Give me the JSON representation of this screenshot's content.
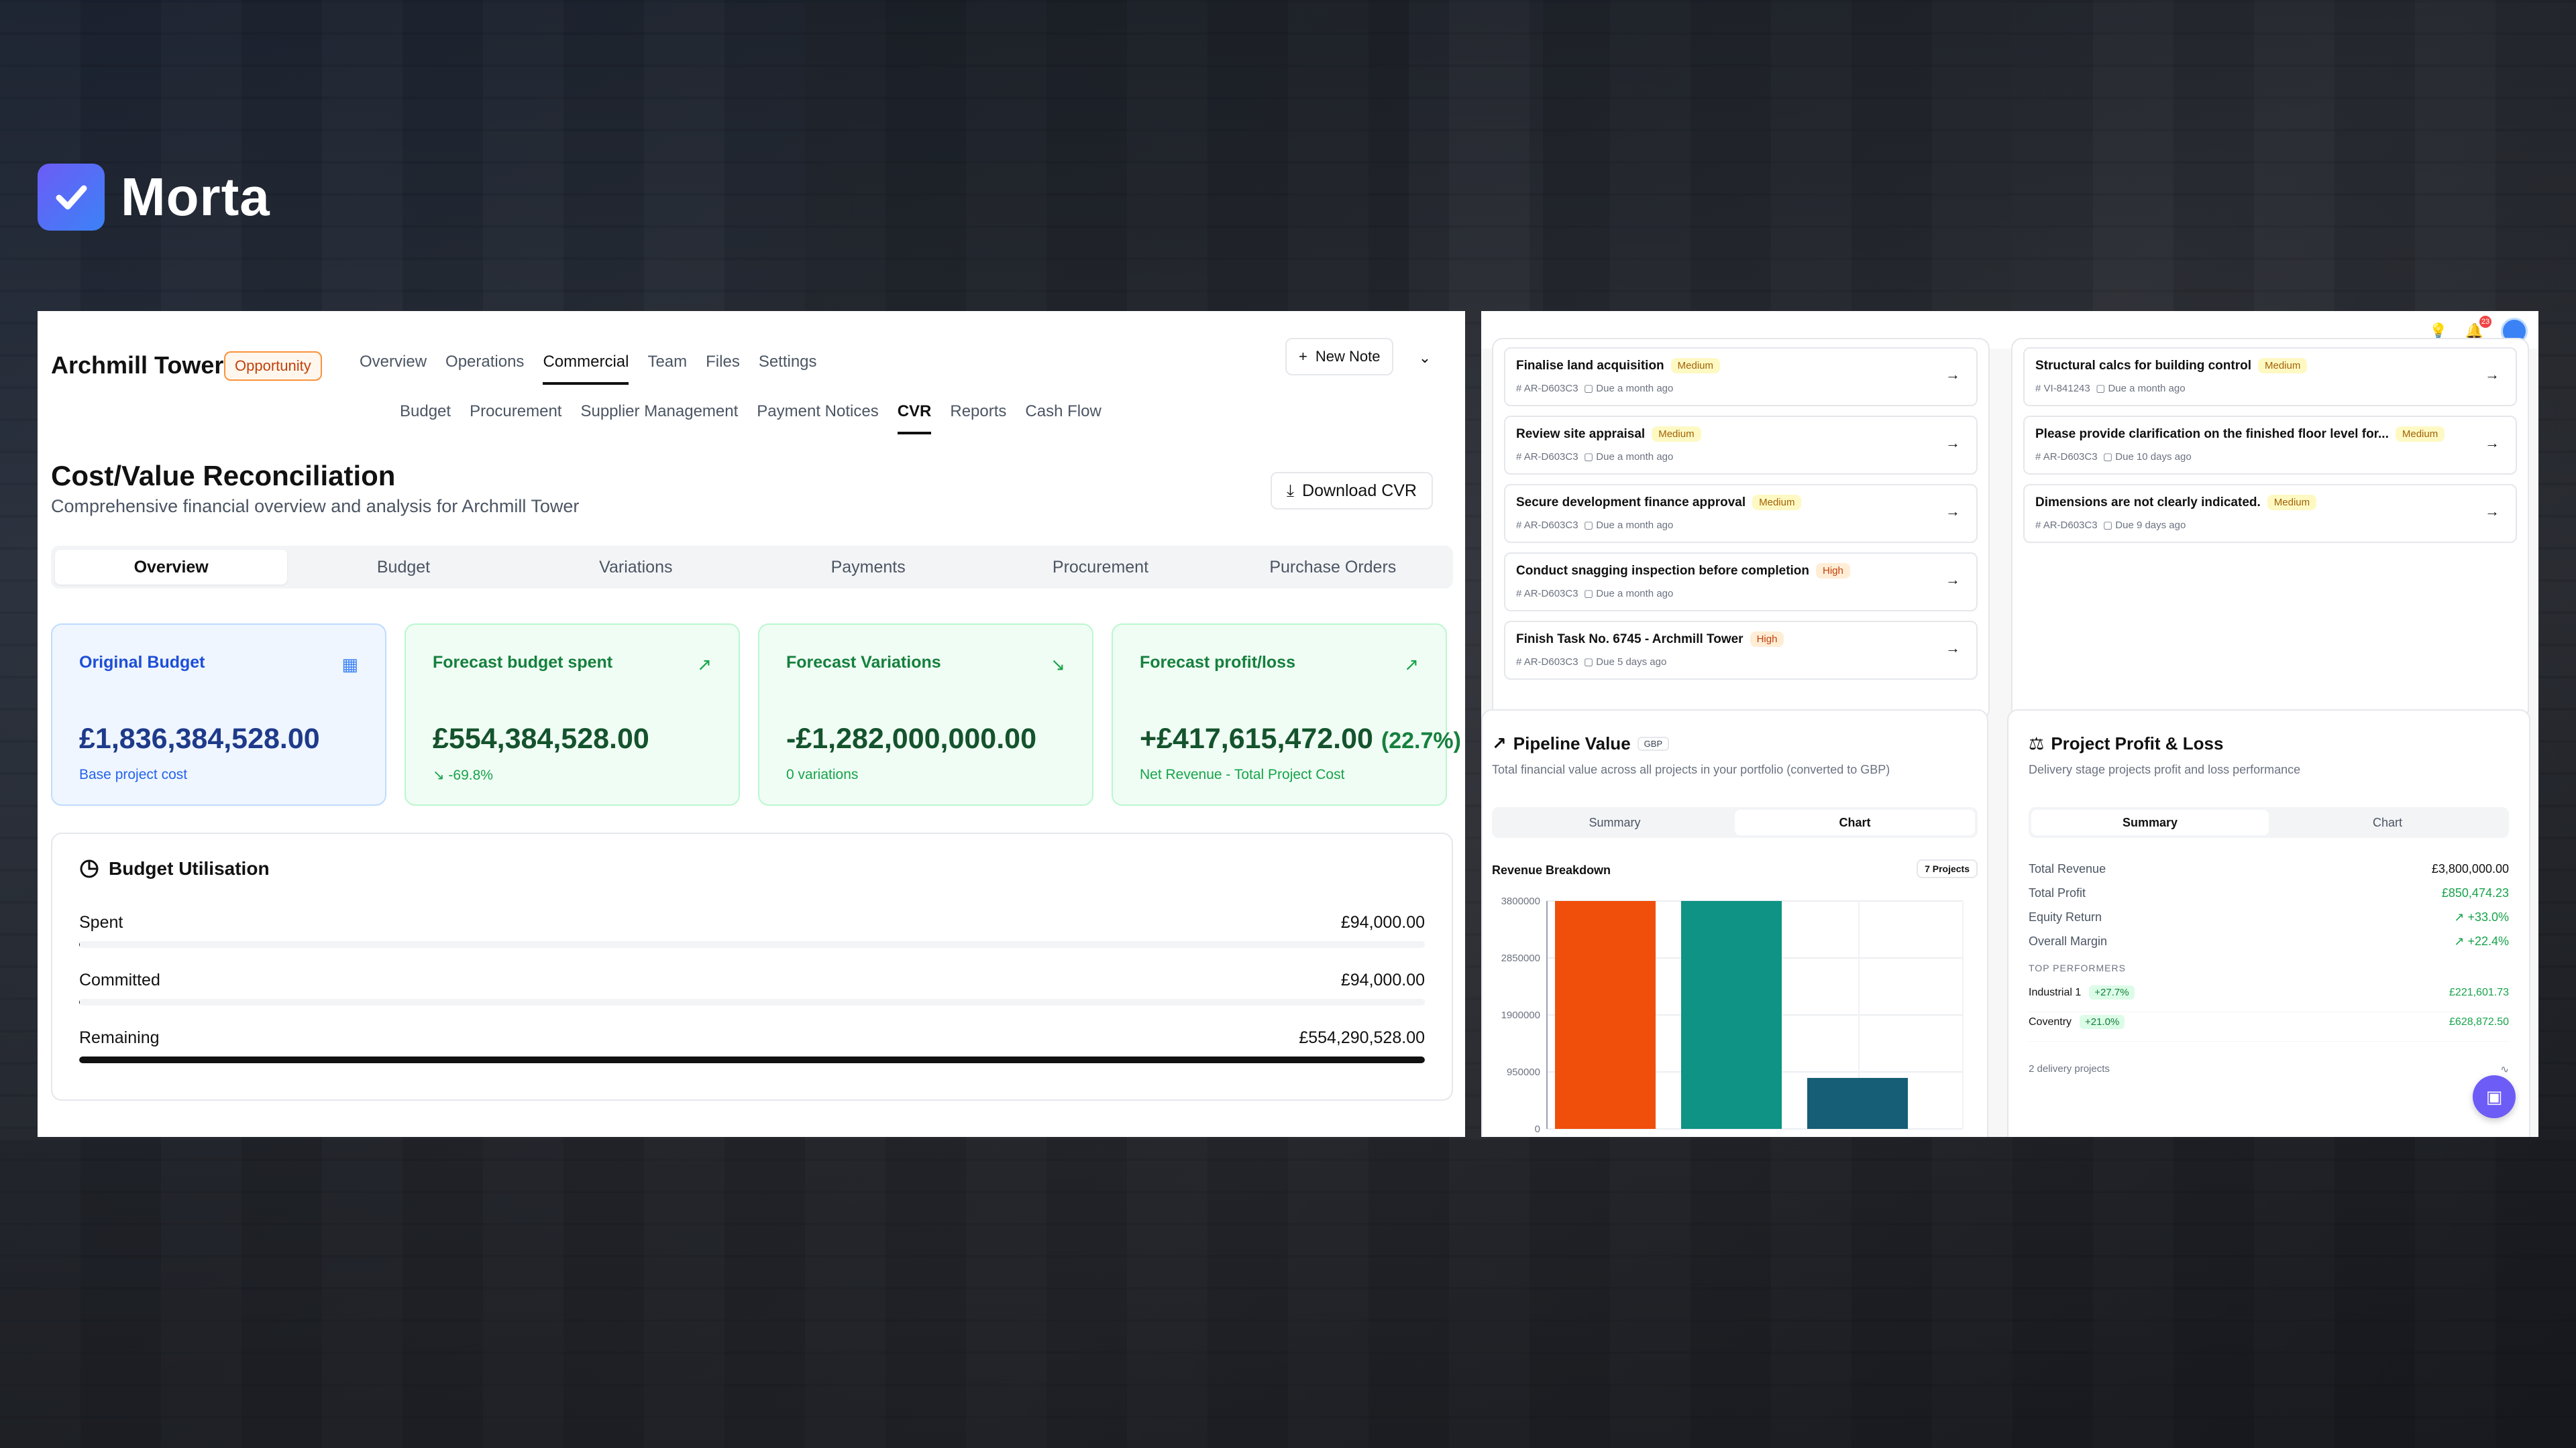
{
  "brand": {
    "name": "Morta",
    "logo_icon": "checkmark-icon",
    "accent": "#6d5cf6"
  },
  "project": {
    "title": "Archmill Tower",
    "badge": "Opportunity"
  },
  "topnav": [
    {
      "label": "Overview"
    },
    {
      "label": "Operations"
    },
    {
      "label": "Commercial",
      "active": true
    },
    {
      "label": "Team"
    },
    {
      "label": "Files"
    },
    {
      "label": "Settings"
    }
  ],
  "subnav": [
    {
      "label": "Budget"
    },
    {
      "label": "Procurement"
    },
    {
      "label": "Supplier Management"
    },
    {
      "label": "Payment Notices"
    },
    {
      "label": "CVR",
      "active": true
    },
    {
      "label": "Reports"
    },
    {
      "label": "Cash Flow"
    }
  ],
  "actions": {
    "new_note": "New Note",
    "download_cvr": "Download CVR"
  },
  "page": {
    "title": "Cost/Value Reconciliation",
    "subtitle": "Comprehensive financial overview and analysis for Archmill Tower"
  },
  "tabs": [
    {
      "label": "Overview",
      "active": true
    },
    {
      "label": "Budget"
    },
    {
      "label": "Variations"
    },
    {
      "label": "Payments"
    },
    {
      "label": "Procurement"
    },
    {
      "label": "Purchase Orders"
    }
  ],
  "cards": [
    {
      "title": "Original Budget",
      "value": "£1,836,384,528.00",
      "note": "Base project cost",
      "icon": "calculator-icon"
    },
    {
      "title": "Forecast budget spent",
      "value": "£554,384,528.00",
      "note": "↘ -69.8%",
      "icon": "trending-up-icon"
    },
    {
      "title": "Forecast Variations",
      "value": "-£1,282,000,000.00",
      "note": "0 variations",
      "icon": "trending-down-icon"
    },
    {
      "title": "Forecast profit/loss",
      "value": "+£417,615,472.00",
      "pct": "(22.7%)",
      "note": "Net Revenue - Total Project Cost",
      "icon": "trending-up-icon"
    }
  ],
  "utilisation": {
    "title": "Budget Utilisation",
    "rows": [
      {
        "label": "Spent",
        "value": "£94,000.00",
        "fraction": 0.0001
      },
      {
        "label": "Committed",
        "value": "£94,000.00",
        "fraction": 0.0001
      },
      {
        "label": "Remaining",
        "value": "£554,290,528.00",
        "fraction": 1.0
      }
    ]
  },
  "notifications": {
    "count": "23"
  },
  "tasks_left": [
    {
      "title": "Finalise land acquisition",
      "priority": "Medium",
      "ref": "AR-D603C3",
      "due": "Due a month ago"
    },
    {
      "title": "Review site appraisal",
      "priority": "Medium",
      "ref": "AR-D603C3",
      "due": "Due a month ago"
    },
    {
      "title": "Secure development finance approval",
      "priority": "Medium",
      "ref": "AR-D603C3",
      "due": "Due a month ago"
    },
    {
      "title": "Conduct snagging inspection before completion",
      "priority": "High",
      "ref": "AR-D603C3",
      "due": "Due a month ago"
    },
    {
      "title": "Finish Task No. 6745 - Archmill Tower",
      "priority": "High",
      "ref": "AR-D603C3",
      "due": "Due 5 days ago"
    }
  ],
  "tasks_right": [
    {
      "title": "Structural calcs for building control",
      "priority": "Medium",
      "ref": "VI-841243",
      "due": "Due a month ago"
    },
    {
      "title": "Please provide clarification on the finished floor level for...",
      "priority": "Medium",
      "ref": "AR-D603C3",
      "due": "Due 10 days ago"
    },
    {
      "title": "Dimensions are not clearly indicated.",
      "priority": "Medium",
      "ref": "AR-D603C3",
      "due": "Due 9 days ago"
    }
  ],
  "pipeline": {
    "title": "Pipeline Value",
    "currency": "GBP",
    "subtitle": "Total financial value across all projects in your portfolio (converted to GBP)",
    "tabs": [
      {
        "label": "Summary"
      },
      {
        "label": "Chart",
        "active": true
      }
    ],
    "chart_title": "Revenue Breakdown",
    "chart_badge": "7 Projects"
  },
  "chart_data": {
    "type": "bar",
    "title": "Revenue Breakdown",
    "categories": [
      "",
      "",
      ""
    ],
    "values": [
      3800000,
      3800000,
      850000
    ],
    "colors": [
      "#f04e0b",
      "#0e9384",
      "#155e75"
    ],
    "yticks": [
      3800000,
      2850000,
      1900000,
      950000,
      0
    ],
    "ytick_labels": [
      "3800000",
      "2850000",
      "1900000",
      "950000",
      "0"
    ],
    "ylim": [
      0,
      3800000
    ],
    "grid": true
  },
  "pnl": {
    "title": "Project Profit & Loss",
    "subtitle": "Delivery stage projects profit and loss performance",
    "tabs": [
      {
        "label": "Summary",
        "active": true
      },
      {
        "label": "Chart"
      }
    ],
    "rows": [
      {
        "label": "Total Revenue",
        "value": "£3,800,000.00"
      },
      {
        "label": "Total Profit",
        "value": "£850,474.23"
      },
      {
        "label": "Equity Return",
        "value": "↗ +33.0%"
      },
      {
        "label": "Overall Margin",
        "value": "↗ +22.4%"
      }
    ],
    "top_label": "TOP PERFORMERS",
    "top": [
      {
        "name": "Industrial 1",
        "pct": "+27.7%",
        "value": "£221,601.73"
      },
      {
        "name": "Coventry",
        "pct": "+21.0%",
        "value": "£628,872.50"
      }
    ],
    "footer": "2 delivery projects"
  }
}
